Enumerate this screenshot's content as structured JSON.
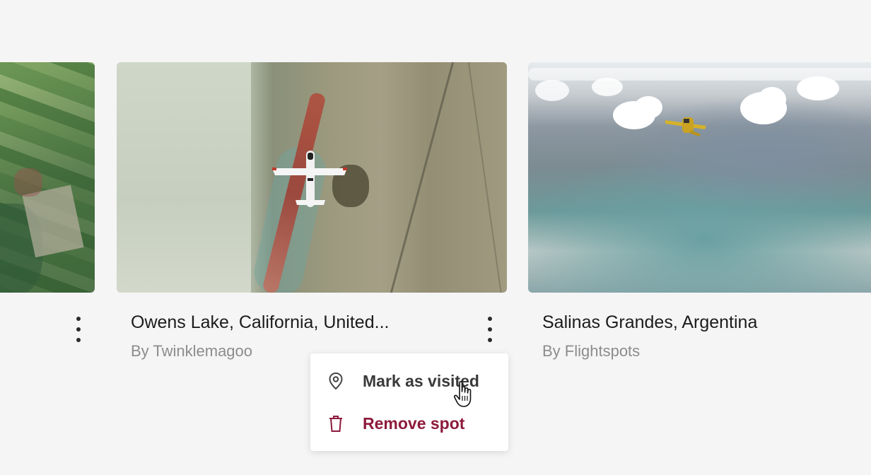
{
  "cards": [
    {
      "title": "",
      "author": ""
    },
    {
      "title": "Owens Lake, California, United...",
      "author": "By Twinklemagoo"
    },
    {
      "title": "Salinas Grandes, Argentina",
      "author": "By Flightspots"
    }
  ],
  "context_menu": {
    "items": [
      {
        "label": "Mark as visited",
        "icon": "location-pin-icon"
      },
      {
        "label": "Remove spot",
        "icon": "trash-icon",
        "color": "#8d1a3c"
      }
    ]
  },
  "icons": {
    "more_options": "vertical-ellipsis-icon",
    "cursor": "hand-pointer-icon"
  },
  "colors": {
    "background": "#f5f5f5",
    "danger": "#8d1a3c",
    "text_primary": "#1c1c1c",
    "text_secondary": "#8c8c8c"
  }
}
